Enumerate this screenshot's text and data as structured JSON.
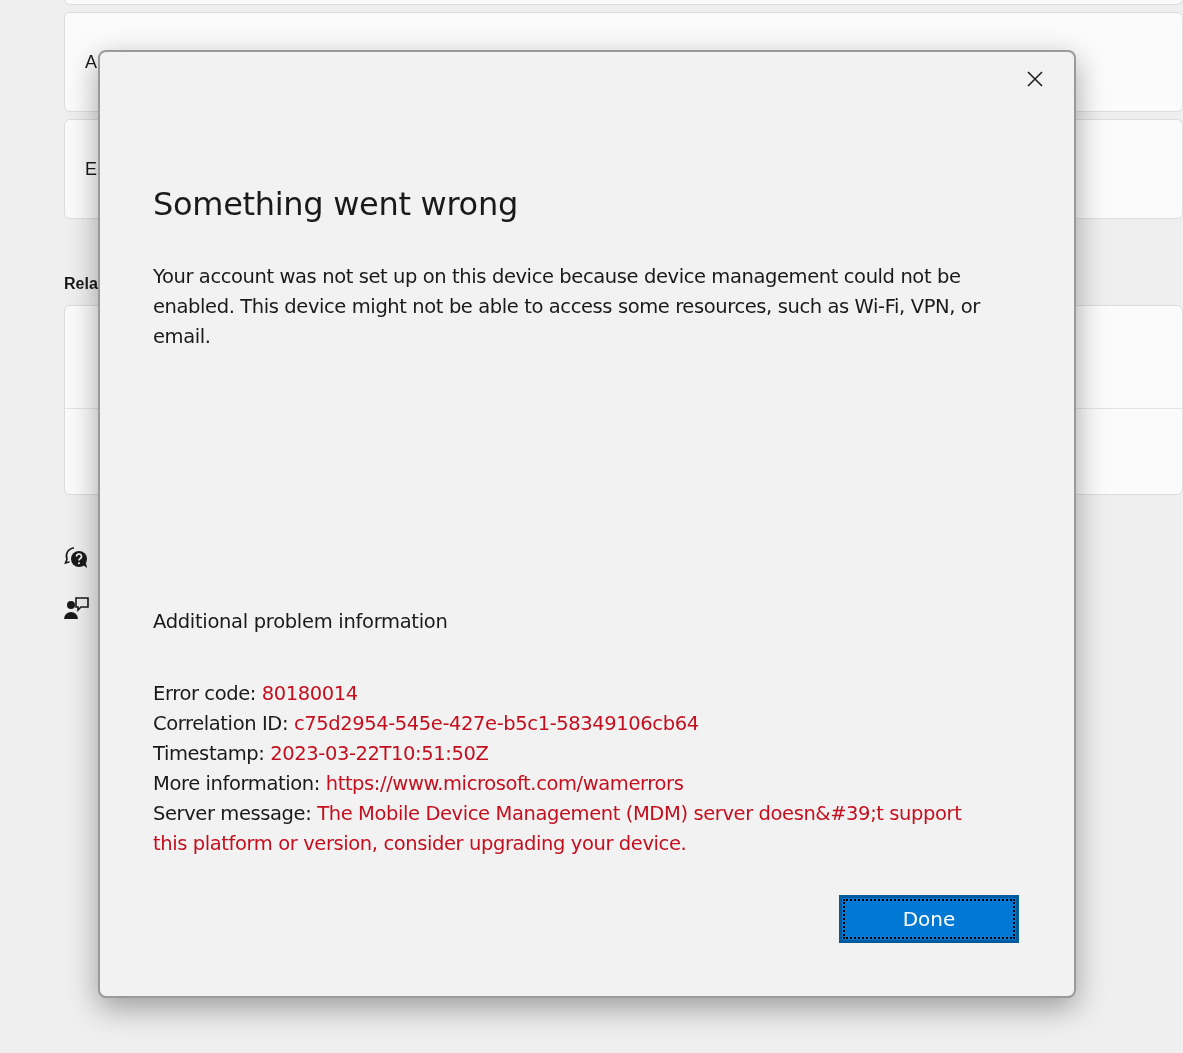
{
  "background": {
    "cards": [
      {
        "label": "A"
      },
      {
        "label": "E"
      }
    ],
    "related_heading": "Rela",
    "side_links": [
      {
        "kind": "help"
      },
      {
        "kind": "feedback"
      }
    ]
  },
  "dialog": {
    "title": "Something went wrong",
    "message": "Your account was not set up on this device because device management could not be enabled. This device might not be able to access some resources, such as Wi-Fi, VPN, or email.",
    "details_heading": "Additional problem information",
    "details": [
      {
        "name": "Error code:",
        "text": "80180014",
        "kind": "text"
      },
      {
        "name": "Correlation ID:",
        "text": "c75d2954-545e-427e-b5c1-58349106cb64",
        "kind": "text"
      },
      {
        "name": "Timestamp:",
        "text": "2023-03-22T10:51:50Z",
        "kind": "text"
      },
      {
        "name": "More information:",
        "text": "https://www.microsoft.com/wamerrors",
        "kind": "link"
      },
      {
        "name": "Server message:",
        "text": "The Mobile Device Management (MDM) server doesn&#39;t support this platform or version, consider upgrading your device.",
        "kind": "text"
      }
    ],
    "button": {
      "label": "Done",
      "focused": true
    }
  }
}
